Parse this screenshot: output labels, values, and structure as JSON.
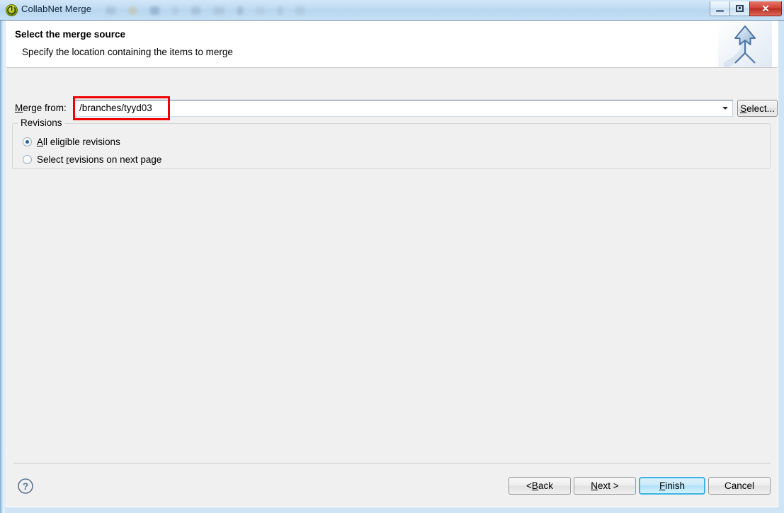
{
  "window": {
    "title": "CollabNet Merge",
    "app_icon": "collabnet-logo-icon",
    "controls": {
      "minimize": "minimize-icon",
      "maximize": "maximize-icon",
      "close": "close-icon",
      "close_glyph": "✕"
    }
  },
  "header": {
    "title": "Select the merge source",
    "description": "Specify the location containing the items to merge",
    "banner_icon": "merge-arrow-icon"
  },
  "form": {
    "merge_from": {
      "label_prefix": "M",
      "label_rest": "erge from:",
      "value": "/branches/tyyd03",
      "placeholder": "",
      "dropdown_icon": "chevron-down-icon",
      "highlight_color": "#ee0000"
    },
    "select_button": {
      "accel": "S",
      "rest": "elect..."
    }
  },
  "revisions": {
    "legend": "Revisions",
    "options": [
      {
        "accel": "A",
        "rest": "ll eligible revisions",
        "full": "All eligible revisions",
        "selected": true
      },
      {
        "prefix": "Select ",
        "accel": "r",
        "rest": "evisions on next page",
        "full": "Select revisions on next page",
        "selected": false
      }
    ]
  },
  "footer": {
    "help_icon": "help-question-icon",
    "buttons": [
      {
        "prefix": "< ",
        "accel": "B",
        "rest": "ack",
        "full": "< Back",
        "default": false
      },
      {
        "prefix": "",
        "accel": "N",
        "rest": "ext >",
        "full": "Next >",
        "default": false
      },
      {
        "prefix": "",
        "accel": "F",
        "rest": "inish",
        "full": "Finish",
        "default": true
      },
      {
        "prefix": "",
        "accel": "",
        "rest": "Cancel",
        "full": "Cancel",
        "default": false
      }
    ]
  },
  "colors": {
    "accent_blue": "#3cb4e5",
    "annotation_red": "#ee0000",
    "dialog_bg": "#f0f0f0",
    "title_glass": "#c2dcf3"
  }
}
